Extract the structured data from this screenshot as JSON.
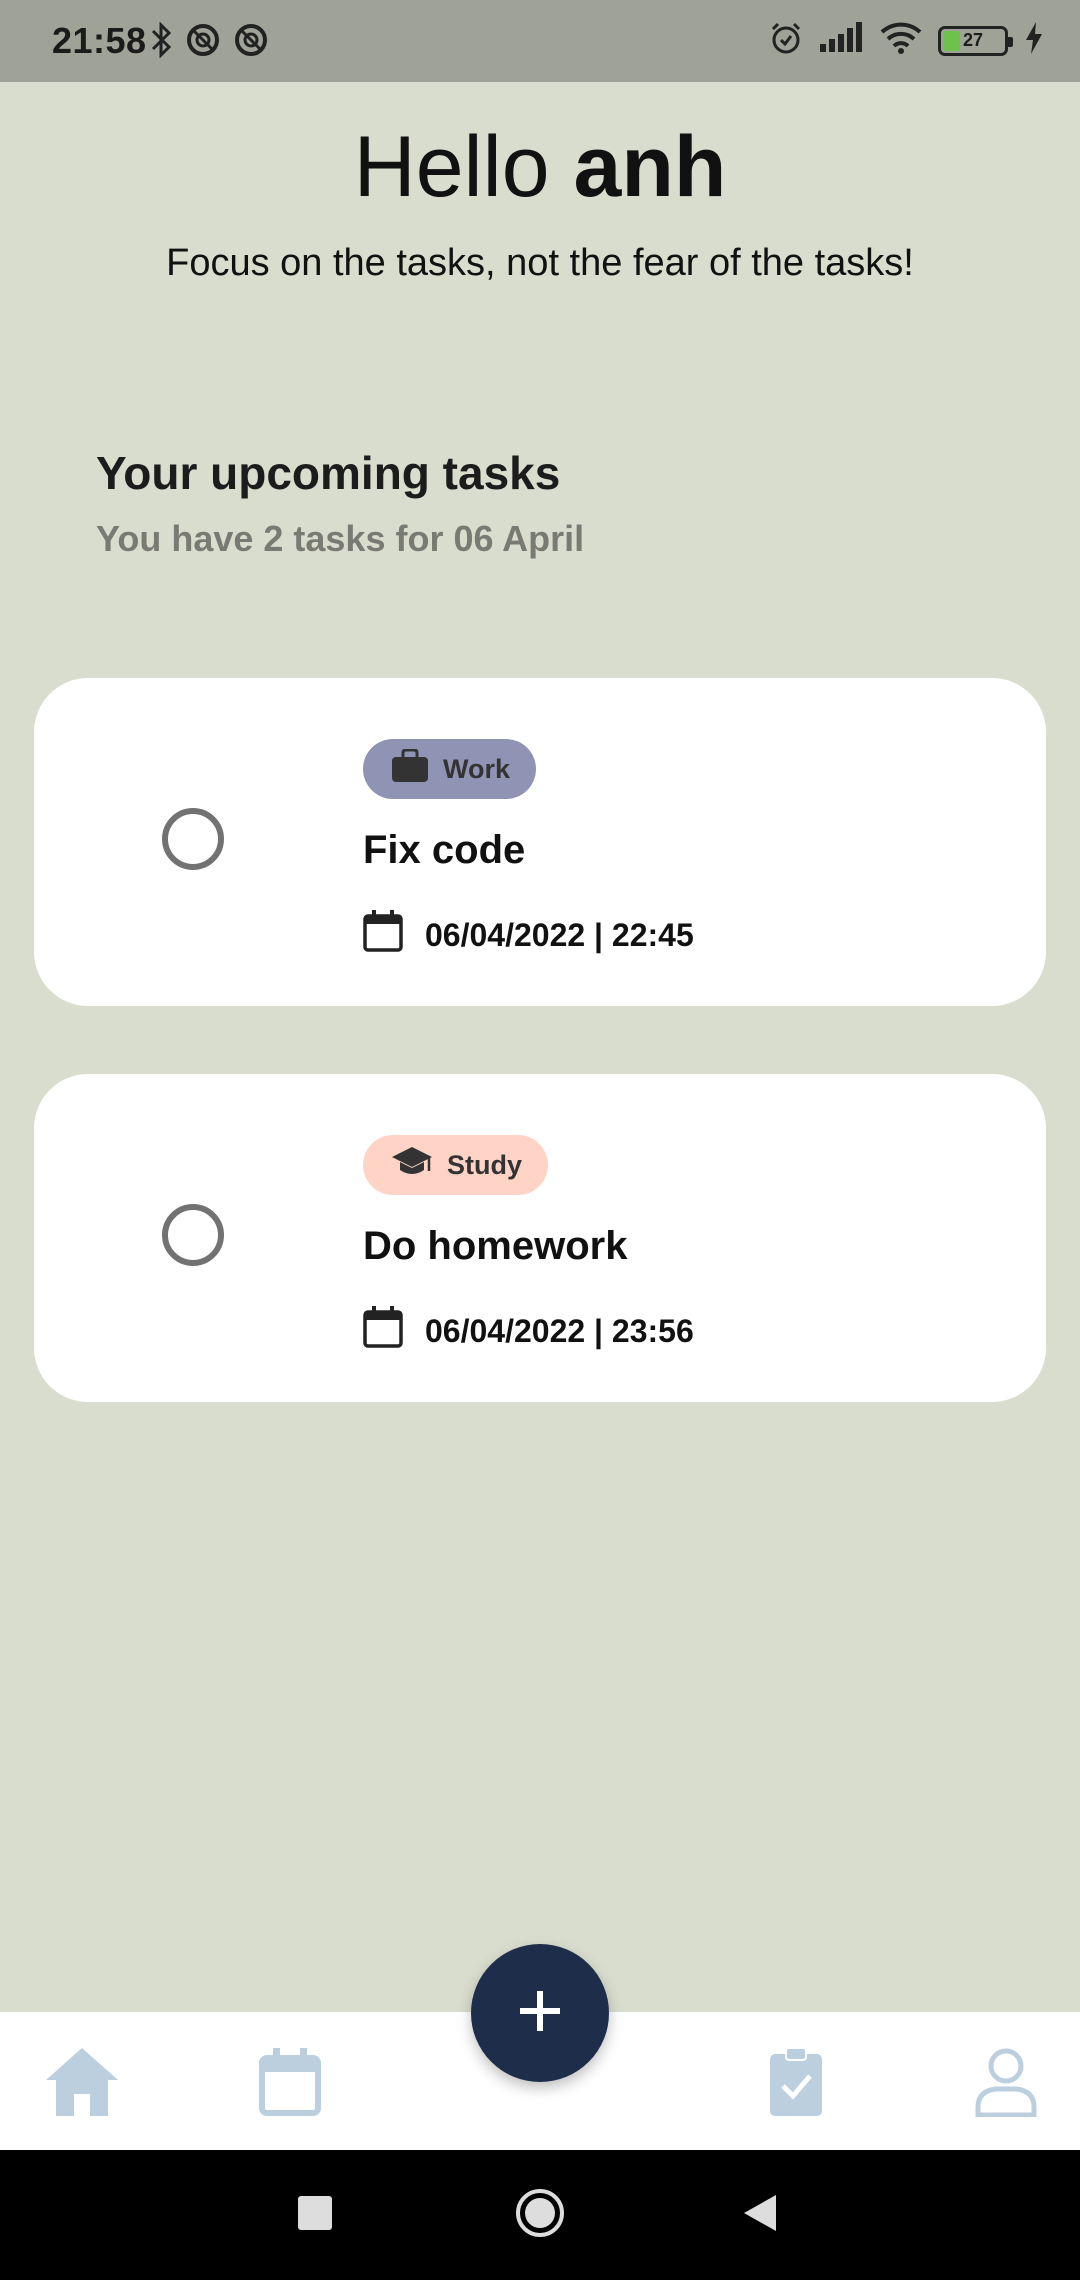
{
  "status_bar": {
    "time": "21:58",
    "battery_percent": "27",
    "battery_level": 0.27,
    "left_icons": [
      "bluetooth-icon",
      "sync-icon",
      "sync-icon"
    ],
    "right_icons": [
      "alarm-icon",
      "signal-icon",
      "wifi-icon",
      "battery-icon",
      "charging-icon"
    ]
  },
  "header": {
    "greeting": "Hello",
    "user_name": "anh",
    "tagline": "Focus on the tasks, not the fear of the tasks!"
  },
  "upcoming": {
    "title": "Your upcoming tasks",
    "subtitle": "You have 2 tasks for 06 April"
  },
  "tasks": [
    {
      "category": "Work",
      "category_icon": "briefcase-icon",
      "category_color": "#8f94b5",
      "title": "Fix code",
      "datetime": "06/04/2022 | 22:45",
      "completed": false
    },
    {
      "category": "Study",
      "category_icon": "graduation-cap-icon",
      "category_color": "#ffd4c6",
      "title": "Do homework",
      "datetime": "06/04/2022 | 23:56",
      "completed": false
    }
  ],
  "bottom_nav": {
    "items": [
      "home-icon",
      "calendar-icon",
      "clipboard-check-icon",
      "profile-icon"
    ],
    "icon_color": "#bccfdf",
    "fab_icon": "plus-icon",
    "fab_color": "#1e2d4a"
  },
  "system_nav": [
    "recent-apps-icon",
    "home-icon",
    "back-icon"
  ],
  "colors": {
    "background": "#d9ddcd",
    "status_bar": "#9fa297",
    "card": "#ffffff"
  }
}
